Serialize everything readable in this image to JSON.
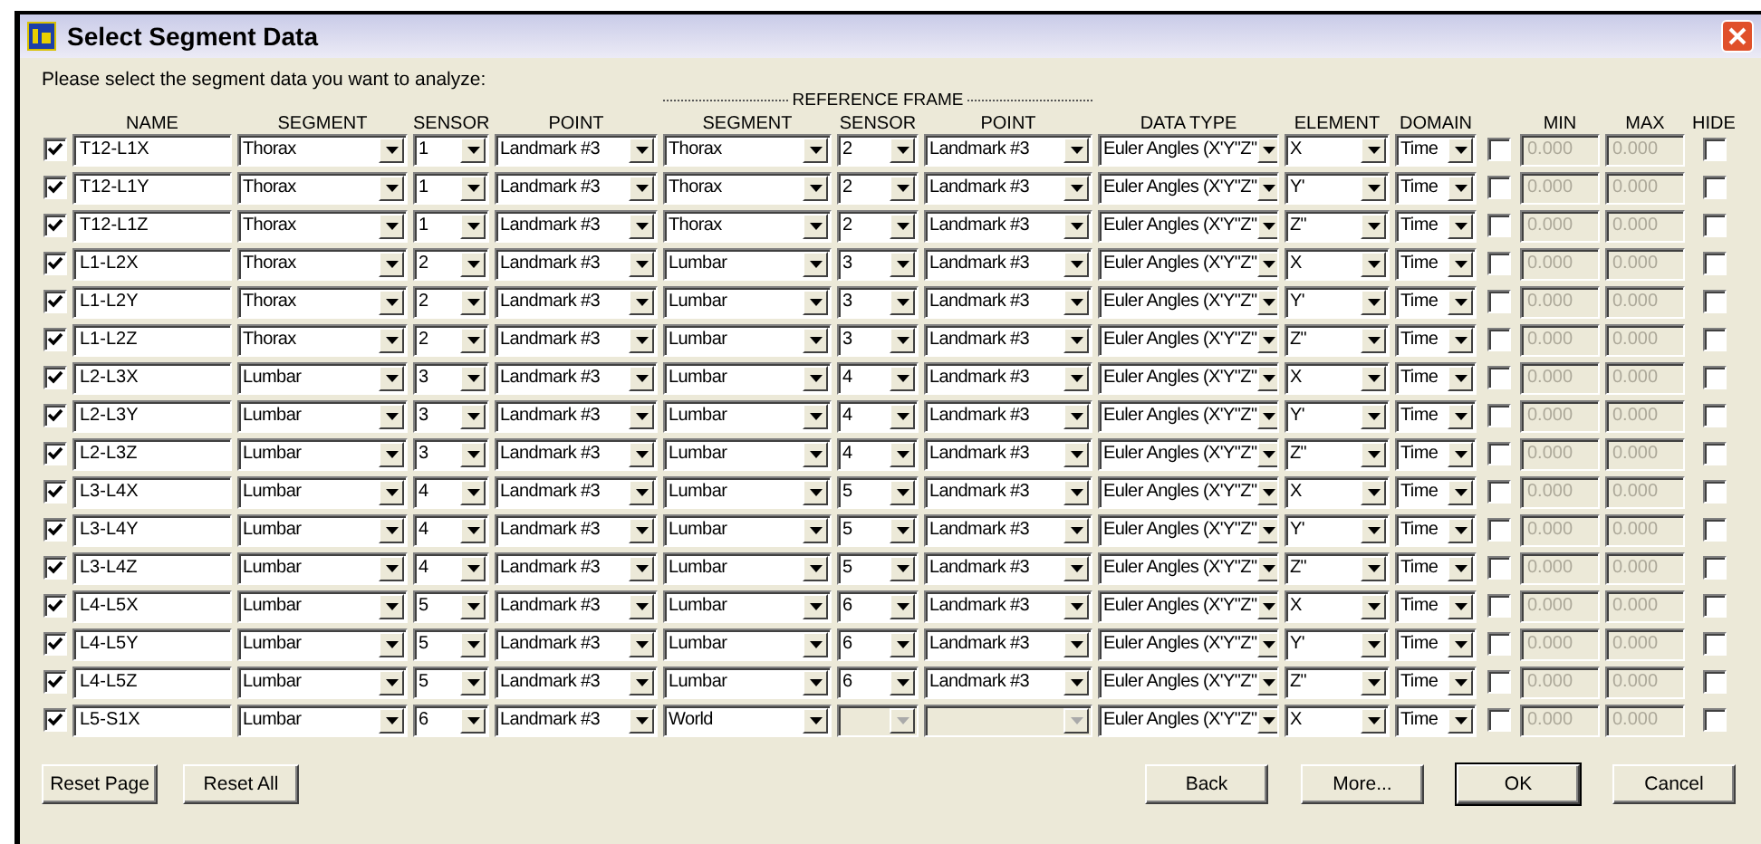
{
  "window": {
    "title": "Select Segment Data"
  },
  "instructions": "Please select the segment data you want to analyze:",
  "reference_frame_label": "REFERENCE FRAME",
  "columns": [
    "NAME",
    "SEGMENT",
    "SENSOR",
    "POINT",
    "SEGMENT",
    "SENSOR",
    "POINT",
    "DATA TYPE",
    "ELEMENT",
    "DOMAIN",
    "MIN",
    "MAX",
    "HIDE"
  ],
  "rows": [
    {
      "checked": true,
      "name": "T12-L1X",
      "segment": "Thorax",
      "sensor": "1",
      "point": "Landmark #3",
      "ref_enabled": true,
      "ref_segment": "Thorax",
      "ref_sensor": "2",
      "ref_point": "Landmark #3",
      "data_type": "Euler Angles (X'Y\"Z\"",
      "element": "X",
      "domain": "Time",
      "range_checked": false,
      "range_enabled": false,
      "min": "0.000",
      "max": "0.000",
      "hide": false
    },
    {
      "checked": true,
      "name": "T12-L1Y",
      "segment": "Thorax",
      "sensor": "1",
      "point": "Landmark #3",
      "ref_enabled": true,
      "ref_segment": "Thorax",
      "ref_sensor": "2",
      "ref_point": "Landmark #3",
      "data_type": "Euler Angles (X'Y\"Z\"",
      "element": "Y'",
      "domain": "Time",
      "range_checked": false,
      "range_enabled": false,
      "min": "0.000",
      "max": "0.000",
      "hide": false
    },
    {
      "checked": true,
      "name": "T12-L1Z",
      "segment": "Thorax",
      "sensor": "1",
      "point": "Landmark #3",
      "ref_enabled": true,
      "ref_segment": "Thorax",
      "ref_sensor": "2",
      "ref_point": "Landmark #3",
      "data_type": "Euler Angles (X'Y\"Z\"",
      "element": "Z\"",
      "domain": "Time",
      "range_checked": false,
      "range_enabled": false,
      "min": "0.000",
      "max": "0.000",
      "hide": false
    },
    {
      "checked": true,
      "name": "L1-L2X",
      "segment": "Thorax",
      "sensor": "2",
      "point": "Landmark #3",
      "ref_enabled": true,
      "ref_segment": "Lumbar",
      "ref_sensor": "3",
      "ref_point": "Landmark #3",
      "data_type": "Euler Angles (X'Y\"Z\"",
      "element": "X",
      "domain": "Time",
      "range_checked": false,
      "range_enabled": false,
      "min": "0.000",
      "max": "0.000",
      "hide": false
    },
    {
      "checked": true,
      "name": "L1-L2Y",
      "segment": "Thorax",
      "sensor": "2",
      "point": "Landmark #3",
      "ref_enabled": true,
      "ref_segment": "Lumbar",
      "ref_sensor": "3",
      "ref_point": "Landmark #3",
      "data_type": "Euler Angles (X'Y\"Z\"",
      "element": "Y'",
      "domain": "Time",
      "range_checked": false,
      "range_enabled": false,
      "min": "0.000",
      "max": "0.000",
      "hide": false
    },
    {
      "checked": true,
      "name": "L1-L2Z",
      "segment": "Thorax",
      "sensor": "2",
      "point": "Landmark #3",
      "ref_enabled": true,
      "ref_segment": "Lumbar",
      "ref_sensor": "3",
      "ref_point": "Landmark #3",
      "data_type": "Euler Angles (X'Y\"Z\"",
      "element": "Z\"",
      "domain": "Time",
      "range_checked": false,
      "range_enabled": false,
      "min": "0.000",
      "max": "0.000",
      "hide": false
    },
    {
      "checked": true,
      "name": "L2-L3X",
      "segment": "Lumbar",
      "sensor": "3",
      "point": "Landmark #3",
      "ref_enabled": true,
      "ref_segment": "Lumbar",
      "ref_sensor": "4",
      "ref_point": "Landmark #3",
      "data_type": "Euler Angles (X'Y\"Z\"",
      "element": "X",
      "domain": "Time",
      "range_checked": false,
      "range_enabled": false,
      "min": "0.000",
      "max": "0.000",
      "hide": false
    },
    {
      "checked": true,
      "name": "L2-L3Y",
      "segment": "Lumbar",
      "sensor": "3",
      "point": "Landmark #3",
      "ref_enabled": true,
      "ref_segment": "Lumbar",
      "ref_sensor": "4",
      "ref_point": "Landmark #3",
      "data_type": "Euler Angles (X'Y\"Z\"",
      "element": "Y'",
      "domain": "Time",
      "range_checked": false,
      "range_enabled": false,
      "min": "0.000",
      "max": "0.000",
      "hide": false
    },
    {
      "checked": true,
      "name": "L2-L3Z",
      "segment": "Lumbar",
      "sensor": "3",
      "point": "Landmark #3",
      "ref_enabled": true,
      "ref_segment": "Lumbar",
      "ref_sensor": "4",
      "ref_point": "Landmark #3",
      "data_type": "Euler Angles (X'Y\"Z\"",
      "element": "Z\"",
      "domain": "Time",
      "range_checked": false,
      "range_enabled": false,
      "min": "0.000",
      "max": "0.000",
      "hide": false
    },
    {
      "checked": true,
      "name": "L3-L4X",
      "segment": "Lumbar",
      "sensor": "4",
      "point": "Landmark #3",
      "ref_enabled": true,
      "ref_segment": "Lumbar",
      "ref_sensor": "5",
      "ref_point": "Landmark #3",
      "data_type": "Euler Angles (X'Y\"Z\"",
      "element": "X",
      "domain": "Time",
      "range_checked": false,
      "range_enabled": false,
      "min": "0.000",
      "max": "0.000",
      "hide": false
    },
    {
      "checked": true,
      "name": "L3-L4Y",
      "segment": "Lumbar",
      "sensor": "4",
      "point": "Landmark #3",
      "ref_enabled": true,
      "ref_segment": "Lumbar",
      "ref_sensor": "5",
      "ref_point": "Landmark #3",
      "data_type": "Euler Angles (X'Y\"Z\"",
      "element": "Y'",
      "domain": "Time",
      "range_checked": false,
      "range_enabled": false,
      "min": "0.000",
      "max": "0.000",
      "hide": false
    },
    {
      "checked": true,
      "name": "L3-L4Z",
      "segment": "Lumbar",
      "sensor": "4",
      "point": "Landmark #3",
      "ref_enabled": true,
      "ref_segment": "Lumbar",
      "ref_sensor": "5",
      "ref_point": "Landmark #3",
      "data_type": "Euler Angles (X'Y\"Z\"",
      "element": "Z\"",
      "domain": "Time",
      "range_checked": false,
      "range_enabled": false,
      "min": "0.000",
      "max": "0.000",
      "hide": false
    },
    {
      "checked": true,
      "name": "L4-L5X",
      "segment": "Lumbar",
      "sensor": "5",
      "point": "Landmark #3",
      "ref_enabled": true,
      "ref_segment": "Lumbar",
      "ref_sensor": "6",
      "ref_point": "Landmark #3",
      "data_type": "Euler Angles (X'Y\"Z\"",
      "element": "X",
      "domain": "Time",
      "range_checked": false,
      "range_enabled": false,
      "min": "0.000",
      "max": "0.000",
      "hide": false
    },
    {
      "checked": true,
      "name": "L4-L5Y",
      "segment": "Lumbar",
      "sensor": "5",
      "point": "Landmark #3",
      "ref_enabled": true,
      "ref_segment": "Lumbar",
      "ref_sensor": "6",
      "ref_point": "Landmark #3",
      "data_type": "Euler Angles (X'Y\"Z\"",
      "element": "Y'",
      "domain": "Time",
      "range_checked": false,
      "range_enabled": false,
      "min": "0.000",
      "max": "0.000",
      "hide": false
    },
    {
      "checked": true,
      "name": "L4-L5Z",
      "segment": "Lumbar",
      "sensor": "5",
      "point": "Landmark #3",
      "ref_enabled": true,
      "ref_segment": "Lumbar",
      "ref_sensor": "6",
      "ref_point": "Landmark #3",
      "data_type": "Euler Angles (X'Y\"Z\"",
      "element": "Z\"",
      "domain": "Time",
      "range_checked": false,
      "range_enabled": false,
      "min": "0.000",
      "max": "0.000",
      "hide": false
    },
    {
      "checked": true,
      "name": "L5-S1X",
      "segment": "Lumbar",
      "sensor": "6",
      "point": "Landmark #3",
      "ref_enabled": false,
      "ref_segment": "World",
      "data_type": "Euler Angles (X'Y\"Z\"",
      "element": "X",
      "domain": "Time",
      "range_checked": false,
      "range_enabled": false,
      "min": "0.000",
      "max": "0.000",
      "hide": false
    }
  ],
  "left_buttons": [
    "Reset Page",
    "Reset All"
  ],
  "right_buttons": [
    {
      "label": "Back",
      "default": false
    },
    {
      "label": "More...",
      "default": false
    },
    {
      "label": "OK",
      "default": true
    },
    {
      "label": "Cancel",
      "default": false
    }
  ]
}
